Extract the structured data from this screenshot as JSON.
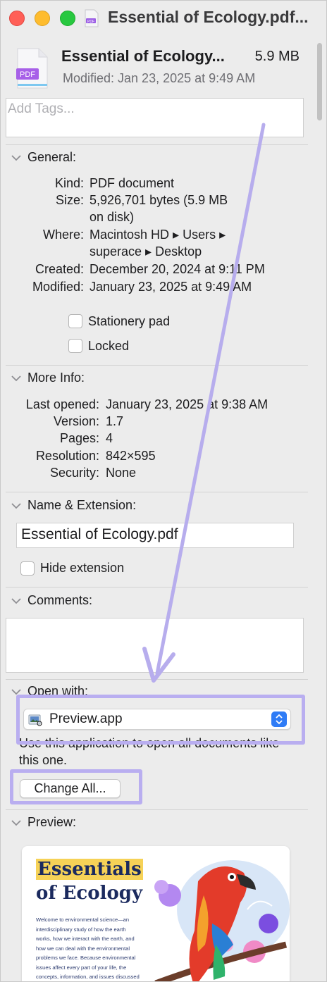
{
  "window": {
    "title": "Essential of Ecology.pdf..."
  },
  "header": {
    "file_icon_label": "PDF",
    "file_name": "Essential of Ecology...",
    "file_size": "5.9 MB",
    "modified": "Modified: Jan 23, 2025 at 9:49 AM"
  },
  "tags": {
    "placeholder": "Add Tags..."
  },
  "general": {
    "title": "General:",
    "rows": [
      {
        "label": "Kind:",
        "value": "PDF document"
      },
      {
        "label": "Size:",
        "value": "5,926,701 bytes (5.9 MB",
        "value2": "on disk)"
      },
      {
        "label": "Where:",
        "value": "Macintosh HD ▸ Users ▸",
        "value2": "superace ▸ Desktop"
      },
      {
        "label": "Created:",
        "value": "December 20, 2024 at 9:11 PM"
      },
      {
        "label": "Modified:",
        "value": "January 23, 2025 at 9:49 AM"
      }
    ],
    "stationery_label": "Stationery pad",
    "locked_label": "Locked"
  },
  "more_info": {
    "title": "More Info:",
    "rows": [
      {
        "label": "Last opened:",
        "value": "January 23, 2025 at 9:38 AM"
      },
      {
        "label": "Version:",
        "value": "1.7"
      },
      {
        "label": "Pages:",
        "value": "4"
      },
      {
        "label": "Resolution:",
        "value": "842×595"
      },
      {
        "label": "Security:",
        "value": "None"
      }
    ]
  },
  "name_ext": {
    "title": "Name & Extension:",
    "value": "Essential of Ecology.pdf",
    "hide_ext_label": "Hide extension"
  },
  "comments": {
    "title": "Comments:"
  },
  "open_with": {
    "title": "Open with:",
    "app": "Preview.app",
    "description": "Use this application to open all documents like this one.",
    "change_all": "Change All..."
  },
  "preview": {
    "title": "Preview:",
    "doc_title_1": "Essentials",
    "doc_title_2": "of Ecology",
    "body": "Welcome to environmental science—an interdisciplinary study of how the earth works, how we interact with the earth, and how we can deal with the environmental problems we face. Because environmental issues affect every part of your life, the concepts, information, and issues discussed in this book and the course you are"
  },
  "colors": {
    "highlight": "#b9aef0",
    "arrow": "#b7aded",
    "accent": "#2f7cf6"
  }
}
